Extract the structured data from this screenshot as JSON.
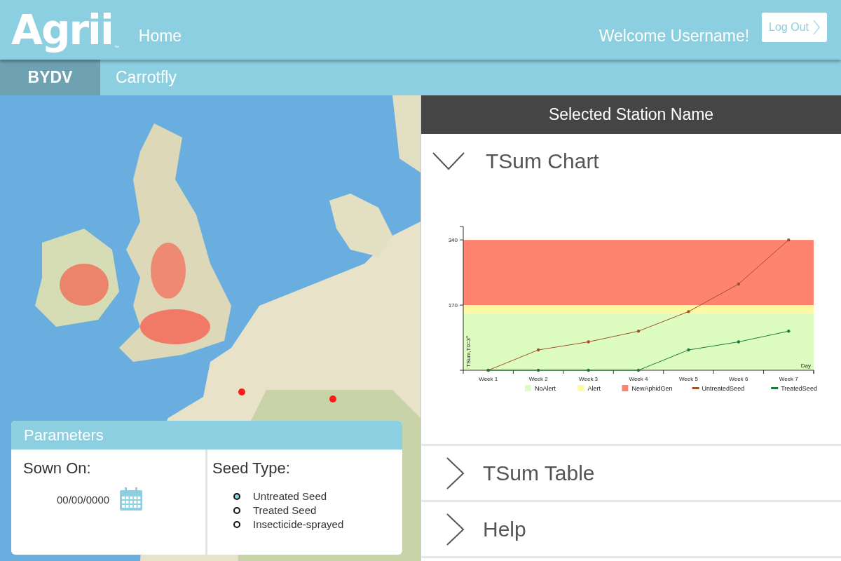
{
  "header": {
    "logo": "Agrii",
    "logo_mark": "™",
    "nav_link": "Home",
    "welcome": "Welcome Username!",
    "logout_button": "Log Out"
  },
  "tabs": [
    {
      "label": "BYDV",
      "selected": true
    },
    {
      "label": "Carrotfly",
      "selected": false
    }
  ],
  "parameters": {
    "title": "Parameters",
    "sown_on": {
      "label": "Sown On:",
      "value": "00/00/0000"
    },
    "seed_type": {
      "label": "Seed Type:",
      "options": [
        {
          "label": "Untreated Seed",
          "selected": true
        },
        {
          "label": "Treated Seed",
          "selected": false
        },
        {
          "label": "Insecticide-sprayed",
          "selected": false
        }
      ]
    }
  },
  "station_panel": {
    "title": "Selected Station Name",
    "sections": [
      {
        "title": "TSum Chart",
        "expanded": true,
        "chart_data": {
          "type": "line",
          "xlabel": "Day",
          "ylabel": "TSum,T0=3°",
          "categories": [
            "Week 1",
            "Week 2",
            "Week 3",
            "Week 4",
            "Week 5",
            "Week 6",
            "Week 7"
          ],
          "ylim": [
            0,
            375
          ],
          "yticks": [
            170,
            340
          ],
          "series": [
            {
              "name": "UntreatedSeed",
              "color": "#a0522d",
              "values": [
                0,
                53,
                74,
                102,
                153,
                225,
                340
              ]
            },
            {
              "name": "TreatedSeed",
              "color": "#1a7a3a",
              "values": [
                0,
                0,
                0,
                0,
                53,
                74,
                102
              ]
            }
          ],
          "legend": "bottom",
          "bands": [
            {
              "label": "NoAlert",
              "axis": "y",
              "from": 0,
              "to": 149,
              "color": "#dcfcc0"
            },
            {
              "label": "Alert",
              "axis": "y",
              "from": 149,
              "to": 170,
              "color": "#fcf9a0"
            },
            {
              "label": "NewAphidGen",
              "axis": "y",
              "from": 170,
              "to": 340,
              "color": "#fe8470"
            }
          ]
        }
      },
      {
        "title": "TSum Table",
        "expanded": false
      },
      {
        "title": "Help",
        "expanded": false
      }
    ]
  }
}
